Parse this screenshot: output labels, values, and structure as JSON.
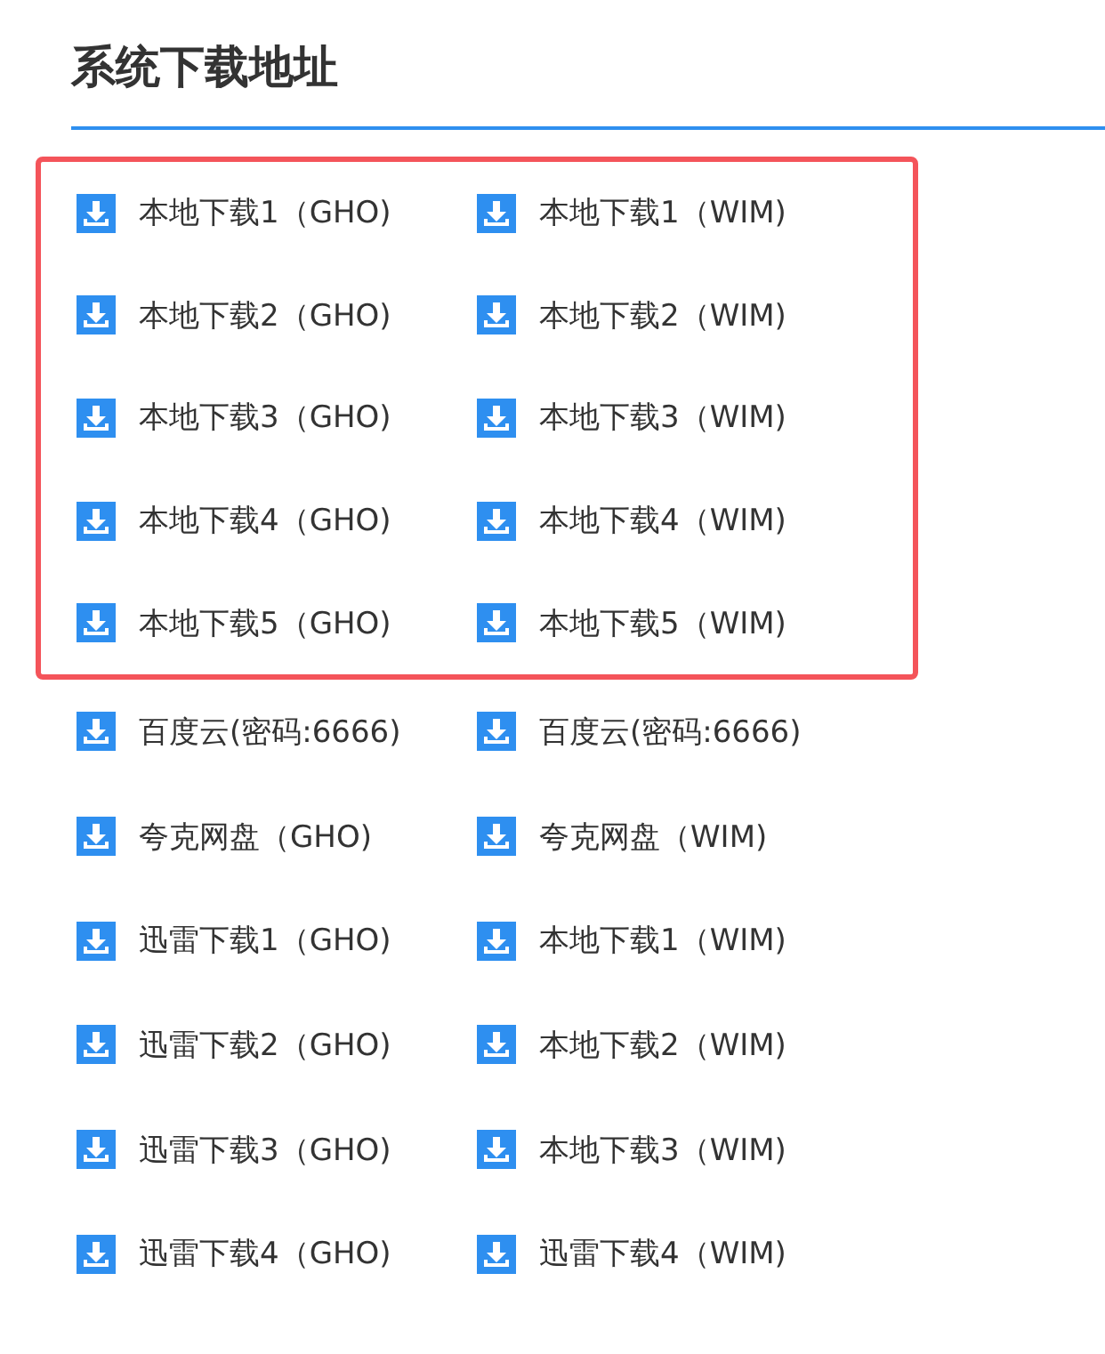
{
  "title": "系统下载地址",
  "groups": [
    {
      "highlighted": true,
      "rows": [
        [
          {
            "label": "本地下载1（GHO)"
          },
          {
            "label": "本地下载1（WIM)"
          }
        ],
        [
          {
            "label": "本地下载2（GHO)"
          },
          {
            "label": "本地下载2（WIM)"
          }
        ],
        [
          {
            "label": "本地下载3（GHO)"
          },
          {
            "label": "本地下载3（WIM)"
          }
        ],
        [
          {
            "label": "本地下载4（GHO)"
          },
          {
            "label": "本地下载4（WIM)"
          }
        ],
        [
          {
            "label": "本地下载5（GHO)"
          },
          {
            "label": "本地下载5（WIM)"
          }
        ]
      ]
    },
    {
      "highlighted": false,
      "rows": [
        [
          {
            "label": "百度云(密码:6666)"
          },
          {
            "label": "百度云(密码:6666)"
          }
        ],
        [
          {
            "label": "夸克网盘（GHO)"
          },
          {
            "label": "夸克网盘（WIM)"
          }
        ],
        [
          {
            "label": "迅雷下载1（GHO)"
          },
          {
            "label": "本地下载1（WIM)"
          }
        ],
        [
          {
            "label": "迅雷下载2（GHO)"
          },
          {
            "label": "本地下载2（WIM)"
          }
        ],
        [
          {
            "label": "迅雷下载3（GHO)"
          },
          {
            "label": "本地下载3（WIM)"
          }
        ],
        [
          {
            "label": "迅雷下载4（GHO)"
          },
          {
            "label": "迅雷下载4（WIM)"
          }
        ]
      ]
    }
  ]
}
